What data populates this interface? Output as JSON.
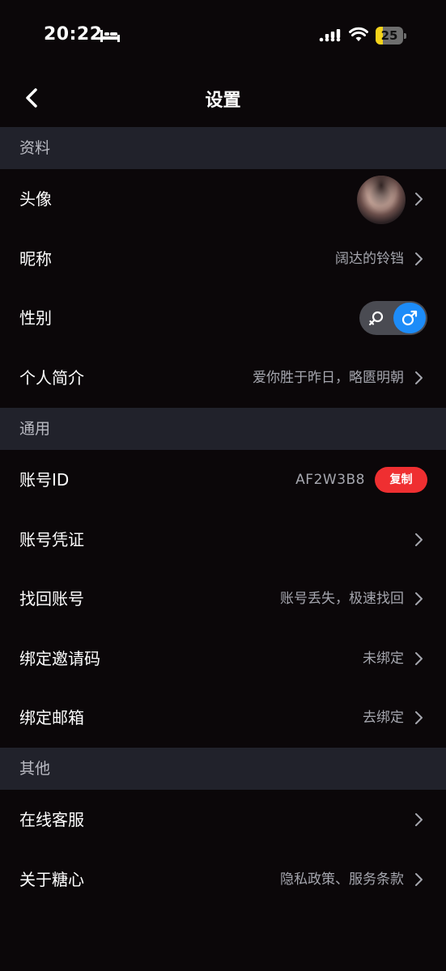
{
  "status_bar": {
    "time": "20:22",
    "battery_level": "25",
    "battery_fraction": 0.25,
    "battery_color": "#f5d31a",
    "icons": [
      "bed-icon",
      "signal-icon",
      "wifi-icon",
      "battery-icon"
    ]
  },
  "nav": {
    "title": "设置",
    "back_icon": "chevron-left-icon"
  },
  "sections": {
    "profile": {
      "header": "资料",
      "avatar_label": "头像",
      "nickname_label": "昵称",
      "nickname_value": "阔达的铃铛",
      "gender_label": "性别",
      "gender_selected": "male",
      "bio_label": "个人简介",
      "bio_value": "爱你胜于昨日，略匮明朝"
    },
    "general": {
      "header": "通用",
      "account_id_label": "账号ID",
      "account_id_value": "AF2W3B8",
      "copy_label": "复制",
      "credential_label": "账号凭证",
      "recover_label": "找回账号",
      "recover_value": "账号丢失，极速找回",
      "invite_label": "绑定邀请码",
      "invite_value": "未绑定",
      "email_label": "绑定邮箱",
      "email_value": "去绑定"
    },
    "other": {
      "header": "其他",
      "support_label": "在线客服",
      "about_label": "关于糖心",
      "about_value": "隐私政策、服务条款"
    }
  },
  "colors": {
    "background": "#0b0709",
    "section_header_bg": "#21222b",
    "accent_blue": "#1d8cf8",
    "copy_red": "#ef2f31"
  }
}
